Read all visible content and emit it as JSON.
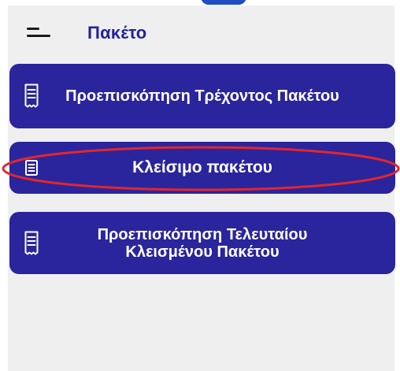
{
  "header": {
    "title": "Πακέτο",
    "menu_icon": "menu-icon"
  },
  "actions": [
    {
      "label": "Προεπισκόπηση Τρέχοντος Πακέτου",
      "icon": "receipt-icon"
    },
    {
      "label": "Κλείσιμο πακέτου",
      "icon": "document-icon"
    },
    {
      "label": "Προεπισκόπηση Τελευταίου Κλεισμένου Πακέτου",
      "icon": "receipt-icon"
    }
  ],
  "colors": {
    "screen_background": "#efefef",
    "title": "#22249a",
    "card_background": "#2a259c",
    "card_text": "#ffffff",
    "highlight": "#e3262c",
    "top_fragment": "#1f4ec2"
  }
}
